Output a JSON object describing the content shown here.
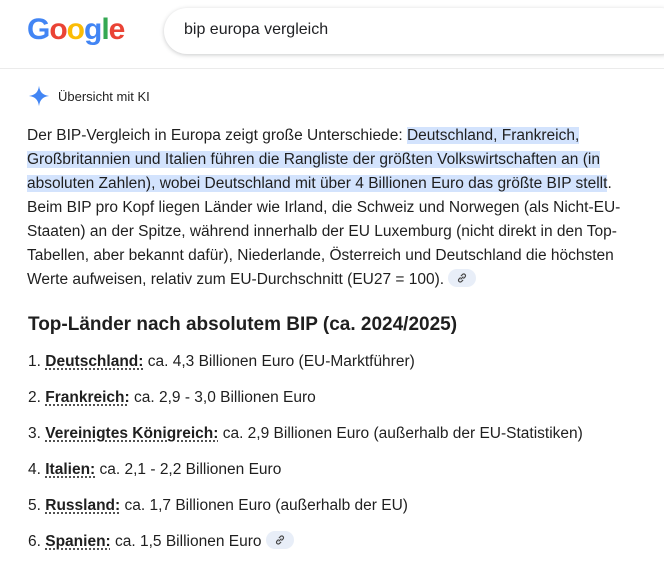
{
  "header": {
    "logo_letters": [
      "G",
      "o",
      "o",
      "g",
      "l",
      "e"
    ],
    "search_value": "bip europa vergleich"
  },
  "ai_overview": {
    "label": "Übersicht mit KI",
    "icon": "sparkle-icon",
    "paragraph_before": "Der BIP-Vergleich in Europa zeigt große Unterschiede: ",
    "paragraph_highlight": "Deutschland, Frankreich, Großbritannien und Italien führen die Rangliste der größten Volkswirtschaften an (in absoluten Zahlen), wobei Deutschland mit über 4 Billionen Euro das größte BIP stellt",
    "paragraph_after": ". Beim BIP pro Kopf liegen Länder wie Irland, die Schweiz und Norwegen (als Nicht-EU-Staaten) an der Spitze, während innerhalb der EU Luxemburg (nicht direkt in den Top-Tabellen, aber bekannt dafür), Niederlande, Österreich und Deutschland die höchsten Werte aufweisen, relativ zum EU-Durchschnitt (EU27 = 100).",
    "section_title": "Top-Länder nach absolutem BIP (ca. 2024/2025)",
    "list": [
      {
        "num": "1.",
        "term": "Deutschland:",
        "text": " ca. 4,3 Billionen Euro (EU-Marktführer)"
      },
      {
        "num": "2.",
        "term": "Frankreich:",
        "text": " ca. 2,9 - 3,0 Billionen Euro"
      },
      {
        "num": "3.",
        "term": "Vereinigtes Königreich:",
        "text": " ca. 2,9 Billionen Euro (außerhalb der EU-Statistiken)"
      },
      {
        "num": "4.",
        "term": "Italien:",
        "text": " ca. 2,1 - 2,2 Billionen Euro"
      },
      {
        "num": "5.",
        "term": "Russland:",
        "text": " ca. 1,7 Billionen Euro (außerhalb der EU)"
      },
      {
        "num": "6.",
        "term": "Spanien:",
        "text": " ca. 1,5 Billionen Euro"
      }
    ]
  },
  "colors": {
    "highlight": "#d3e3fd",
    "sparkle": "#4285f4",
    "chip_bg": "#e8eef8"
  }
}
